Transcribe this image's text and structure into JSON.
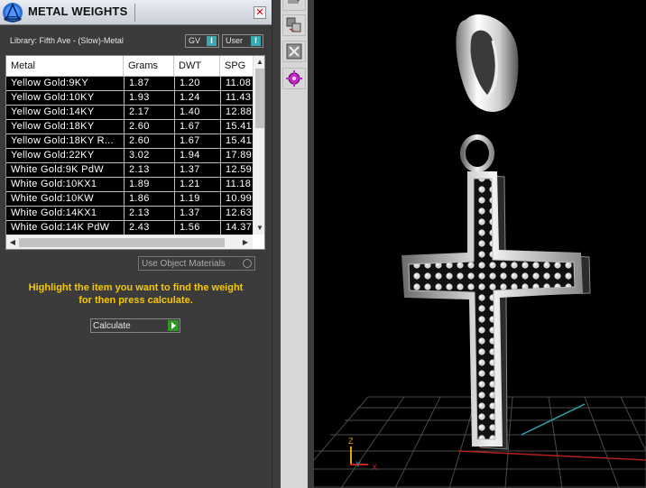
{
  "window": {
    "title": "METAL WEIGHTS",
    "close_glyph": "✕"
  },
  "library": {
    "label": "Library: Fifth Ave - (Slow)-Metal"
  },
  "toggles": {
    "gv_label": "GV",
    "user_label": "User",
    "indicator": "I"
  },
  "table": {
    "columns": [
      "Metal",
      "Grams",
      "DWT",
      "SPG"
    ],
    "rows": [
      {
        "metal": "Yellow Gold:9KY",
        "grams": "1.87",
        "dwt": "1.20",
        "spg": "11.08"
      },
      {
        "metal": "Yellow Gold:10KY",
        "grams": "1.93",
        "dwt": "1.24",
        "spg": "11.43"
      },
      {
        "metal": "Yellow Gold:14KY",
        "grams": "2.17",
        "dwt": "1.40",
        "spg": "12.88"
      },
      {
        "metal": "Yellow Gold:18KY",
        "grams": "2.60",
        "dwt": "1.67",
        "spg": "15.41"
      },
      {
        "metal": "Yellow Gold:18KY R...",
        "grams": "2.60",
        "dwt": "1.67",
        "spg": "15.41"
      },
      {
        "metal": "Yellow Gold:22KY",
        "grams": "3.02",
        "dwt": "1.94",
        "spg": "17.89"
      },
      {
        "metal": "White Gold:9K PdW",
        "grams": "2.13",
        "dwt": "1.37",
        "spg": "12.59"
      },
      {
        "metal": "White Gold:10KX1",
        "grams": "1.89",
        "dwt": "1.21",
        "spg": "11.18"
      },
      {
        "metal": "White Gold:10KW",
        "grams": "1.86",
        "dwt": "1.19",
        "spg": "10.99"
      },
      {
        "metal": "White Gold:14KX1",
        "grams": "2.13",
        "dwt": "1.37",
        "spg": "12.63"
      },
      {
        "metal": "White Gold:14K PdW",
        "grams": "2.43",
        "dwt": "1.56",
        "spg": "14.37"
      }
    ]
  },
  "options": {
    "use_object_materials": "Use Object Materials"
  },
  "instruction": {
    "line1": "Highlight the item you want to find the weight",
    "line2": "for then press calculate."
  },
  "calculate": {
    "label": "Calculate"
  },
  "axis": {
    "z": "Z",
    "y": "Y",
    "x": "X"
  },
  "colors": {
    "panel_bg": "#3b3b3b",
    "instruction": "#f7c800",
    "toggle_on": "#3aa8b0",
    "calc_go": "#2d9a1f",
    "viewport_bg": "#000000"
  }
}
